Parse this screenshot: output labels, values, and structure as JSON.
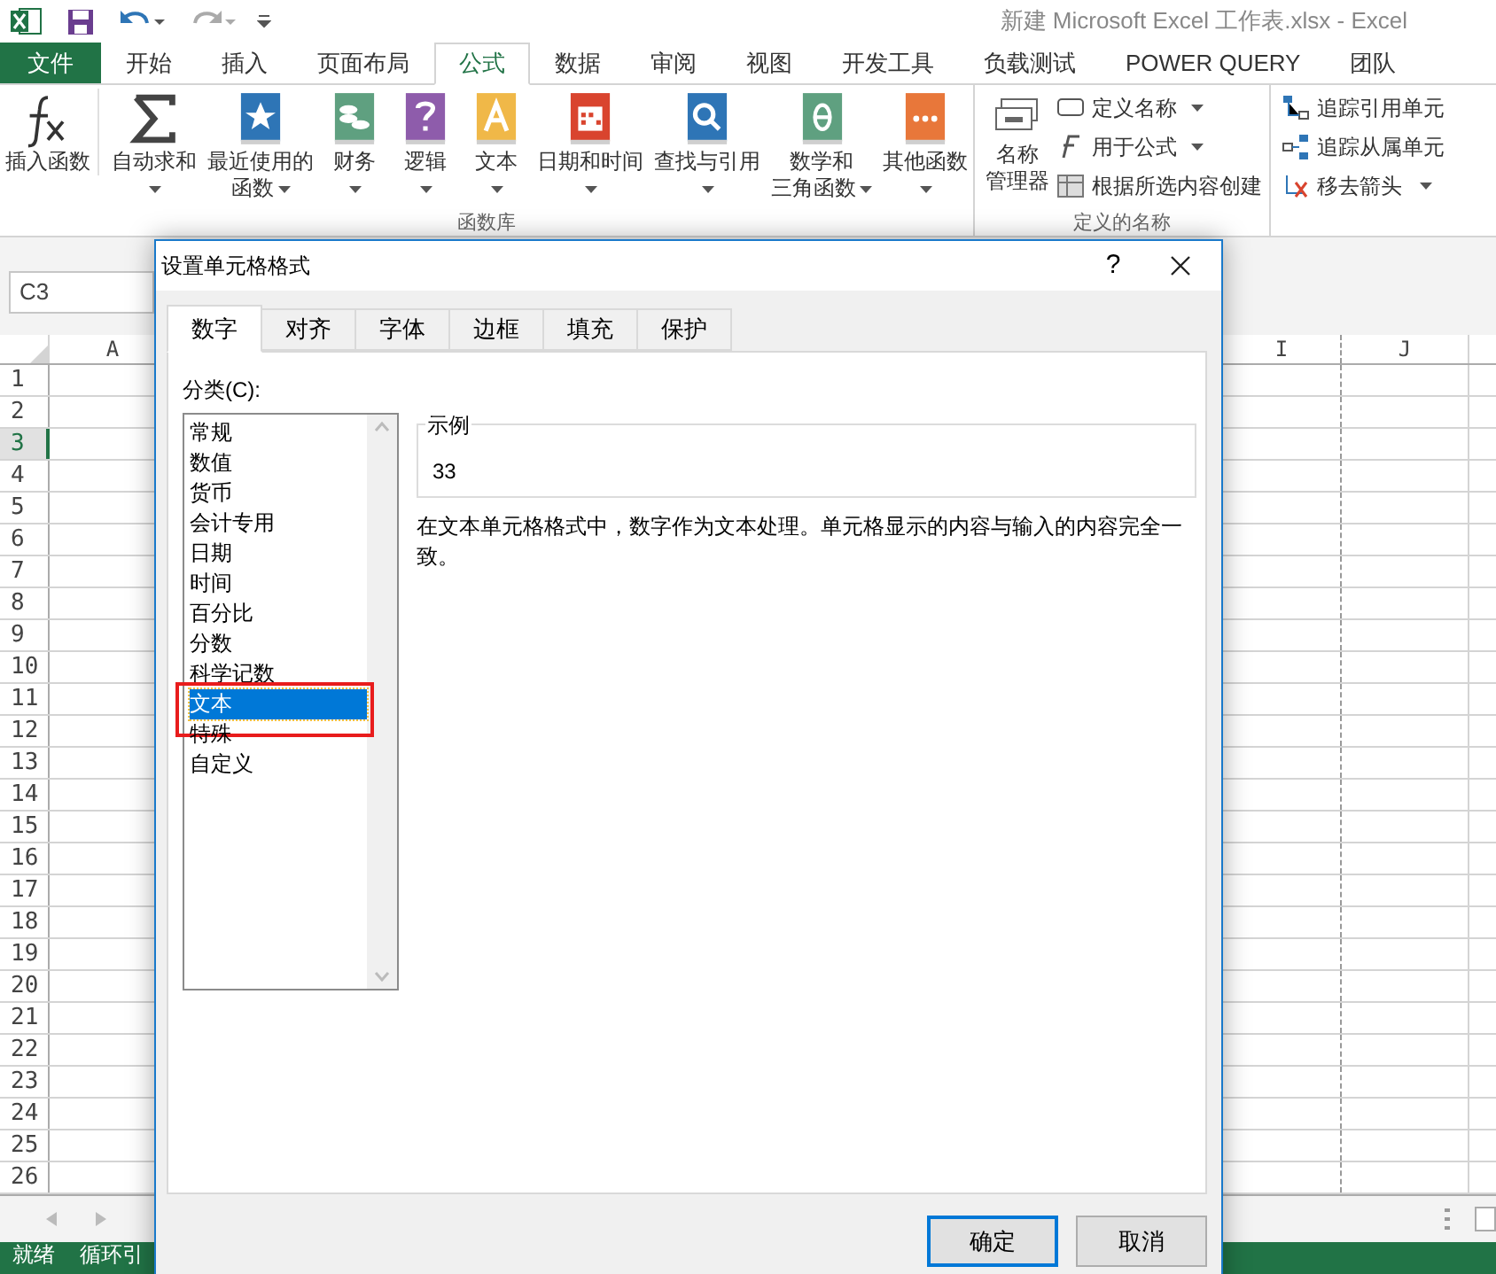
{
  "window": {
    "title": "新建 Microsoft Excel 工作表.xlsx - Excel"
  },
  "ribbon_tabs": [
    {
      "label": "文件",
      "kind": "file",
      "selected": false
    },
    {
      "label": "开始",
      "kind": "tab",
      "selected": false
    },
    {
      "label": "插入",
      "kind": "tab",
      "selected": false
    },
    {
      "label": "页面布局",
      "kind": "tab",
      "selected": false
    },
    {
      "label": "公式",
      "kind": "tab",
      "selected": true
    },
    {
      "label": "数据",
      "kind": "tab",
      "selected": false
    },
    {
      "label": "审阅",
      "kind": "tab",
      "selected": false
    },
    {
      "label": "视图",
      "kind": "tab",
      "selected": false
    },
    {
      "label": "开发工具",
      "kind": "tab",
      "selected": false
    },
    {
      "label": "负载测试",
      "kind": "tab",
      "selected": false
    },
    {
      "label": "POWER QUERY",
      "kind": "tab",
      "selected": false
    },
    {
      "label": "团队",
      "kind": "tab",
      "selected": false
    }
  ],
  "function_library": {
    "label": "函数库",
    "buttons": [
      {
        "lines": [
          "插入函数"
        ],
        "kind": "fx",
        "menu": false
      },
      {
        "lines": [
          "自动求和"
        ],
        "kind": "sum",
        "menu": true
      },
      {
        "lines": [
          "最近使用的",
          "函数"
        ],
        "kind": "recent",
        "menu": true
      },
      {
        "lines": [
          "财务"
        ],
        "kind": "financial",
        "menu": true
      },
      {
        "lines": [
          "逻辑"
        ],
        "kind": "logical",
        "menu": true
      },
      {
        "lines": [
          "文本"
        ],
        "kind": "text",
        "menu": true
      },
      {
        "lines": [
          "日期和时间"
        ],
        "kind": "datetime",
        "menu": true
      },
      {
        "lines": [
          "查找与引用"
        ],
        "kind": "lookup",
        "menu": true
      },
      {
        "lines": [
          "数学和",
          "三角函数"
        ],
        "kind": "math",
        "menu": true
      },
      {
        "lines": [
          "其他函数"
        ],
        "kind": "more",
        "menu": true
      }
    ]
  },
  "defined_names": {
    "label": "定义的名称",
    "manager": [
      "名称",
      "管理器"
    ],
    "items": [
      {
        "label": "定义名称",
        "kind": "define",
        "menu": true
      },
      {
        "label": "用于公式",
        "kind": "use",
        "menu": true
      },
      {
        "label": "根据所选内容创建",
        "kind": "create",
        "menu": false
      }
    ]
  },
  "auditing": {
    "items": [
      {
        "label": "追踪引用单元",
        "kind": "precedents",
        "menu": false
      },
      {
        "label": "追踪从属单元",
        "kind": "dependents",
        "menu": false
      },
      {
        "label": "移去箭头",
        "kind": "remove",
        "menu": true
      }
    ]
  },
  "name_box": {
    "value": "C3"
  },
  "sheet": {
    "columns": [
      {
        "label": "A"
      },
      {
        "label": "I"
      },
      {
        "label": "J"
      }
    ],
    "rows": [
      {
        "label": "1",
        "selected": false
      },
      {
        "label": "2",
        "selected": false
      },
      {
        "label": "3",
        "selected": true
      },
      {
        "label": "4",
        "selected": false
      },
      {
        "label": "5",
        "selected": false
      },
      {
        "label": "6",
        "selected": false
      },
      {
        "label": "7",
        "selected": false
      },
      {
        "label": "8",
        "selected": false
      },
      {
        "label": "9",
        "selected": false
      },
      {
        "label": "10",
        "selected": false
      },
      {
        "label": "11",
        "selected": false
      },
      {
        "label": "12",
        "selected": false
      },
      {
        "label": "13",
        "selected": false
      },
      {
        "label": "14",
        "selected": false
      },
      {
        "label": "15",
        "selected": false
      },
      {
        "label": "16",
        "selected": false
      },
      {
        "label": "17",
        "selected": false
      },
      {
        "label": "18",
        "selected": false
      },
      {
        "label": "19",
        "selected": false
      },
      {
        "label": "20",
        "selected": false
      },
      {
        "label": "21",
        "selected": false
      },
      {
        "label": "22",
        "selected": false
      },
      {
        "label": "23",
        "selected": false
      },
      {
        "label": "24",
        "selected": false
      },
      {
        "label": "25",
        "selected": false
      },
      {
        "label": "26",
        "selected": false
      }
    ]
  },
  "status_bar": [
    "就绪",
    "循环引"
  ],
  "dialog": {
    "title": "设置单元格格式",
    "help": "?",
    "tabs": [
      {
        "label": "数字",
        "selected": true
      },
      {
        "label": "对齐",
        "selected": false
      },
      {
        "label": "字体",
        "selected": false
      },
      {
        "label": "边框",
        "selected": false
      },
      {
        "label": "填充",
        "selected": false
      },
      {
        "label": "保护",
        "selected": false
      }
    ],
    "category_label": "分类(C):",
    "categories": [
      {
        "label": "常规",
        "selected": false
      },
      {
        "label": "数值",
        "selected": false
      },
      {
        "label": "货币",
        "selected": false
      },
      {
        "label": "会计专用",
        "selected": false
      },
      {
        "label": "日期",
        "selected": false
      },
      {
        "label": "时间",
        "selected": false
      },
      {
        "label": "百分比",
        "selected": false
      },
      {
        "label": "分数",
        "selected": false
      },
      {
        "label": "科学记数",
        "selected": false
      },
      {
        "label": "文本",
        "selected": true
      },
      {
        "label": "特殊",
        "selected": false
      },
      {
        "label": "自定义",
        "selected": false
      }
    ],
    "sample": {
      "legend": "示例",
      "value": "33"
    },
    "description": "在文本单元格格式中，数字作为文本处理。单元格显示的内容与输入的内容完全一致。",
    "buttons": [
      {
        "label": "确定",
        "default": true
      },
      {
        "label": "取消",
        "default": false
      }
    ]
  }
}
